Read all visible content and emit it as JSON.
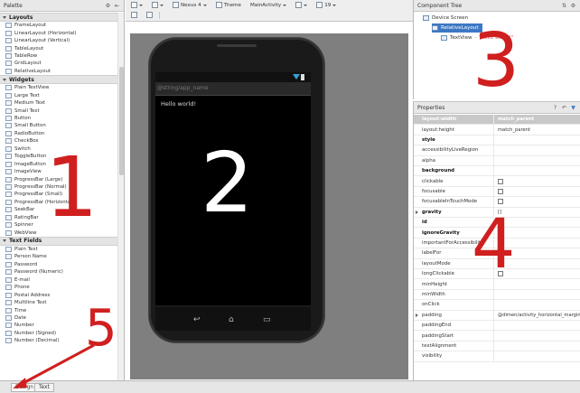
{
  "palette": {
    "title": "Palette",
    "groups": [
      {
        "label": "Layouts",
        "items": [
          "FrameLayout",
          "LinearLayout (Horizontal)",
          "LinearLayout (Vertical)",
          "TableLayout",
          "TableRow",
          "GridLayout",
          "RelativeLayout"
        ]
      },
      {
        "label": "Widgets",
        "items": [
          "Plain TextView",
          "Large Text",
          "Medium Text",
          "Small Text",
          "Button",
          "Small Button",
          "RadioButton",
          "CheckBox",
          "Switch",
          "ToggleButton",
          "ImageButton",
          "ImageView",
          "ProgressBar (Large)",
          "ProgressBar (Normal)",
          "ProgressBar (Small)",
          "ProgressBar (Horizontal)",
          "SeekBar",
          "RatingBar",
          "Spinner",
          "WebView"
        ]
      },
      {
        "label": "Text Fields",
        "items": [
          "Plain Text",
          "Person Name",
          "Password",
          "Password (Numeric)",
          "E-mail",
          "Phone",
          "Postal Address",
          "Multiline Text",
          "Time",
          "Date",
          "Number",
          "Number (Signed)",
          "Number (Decimal)"
        ]
      }
    ]
  },
  "toolbar": {
    "device": "Nexus 4",
    "theme": "Theme",
    "activity": "MainActivity",
    "api": "19"
  },
  "phone": {
    "action_bar_title": "@string/app_name",
    "hello_text": "Hello world!",
    "nav_back": "↩",
    "nav_home": "⌂",
    "nav_recent": "▭"
  },
  "component_tree": {
    "title": "Component Tree",
    "nodes": [
      {
        "label": "Device Screen",
        "depth": 0
      },
      {
        "label": "RelativeLayout",
        "depth": 1,
        "selected": true
      },
      {
        "label": "TextView",
        "depth": 2,
        "suffix": "- \"Hello world!\""
      }
    ]
  },
  "properties": {
    "title": "Properties",
    "rows": [
      {
        "name": "layout:width",
        "value": "match_parent",
        "header": true
      },
      {
        "name": "layout:height",
        "value": "match_parent"
      },
      {
        "name": "style",
        "value": "",
        "bold": true
      },
      {
        "name": "accessibilityLiveRegion",
        "value": ""
      },
      {
        "name": "alpha",
        "value": ""
      },
      {
        "name": "background",
        "value": "",
        "bold": true
      },
      {
        "name": "clickable",
        "value": "",
        "checkbox": true
      },
      {
        "name": "focusable",
        "value": "",
        "checkbox": true
      },
      {
        "name": "focusableInTouchMode",
        "value": "",
        "checkbox": true
      },
      {
        "name": "gravity",
        "value": "[]",
        "bold": true,
        "expand": true
      },
      {
        "name": "id",
        "value": "",
        "bold": true
      },
      {
        "name": "ignoreGravity",
        "value": "",
        "bold": true
      },
      {
        "name": "importantForAccessibility",
        "value": ""
      },
      {
        "name": "labelFor",
        "value": ""
      },
      {
        "name": "layoutMode",
        "value": ""
      },
      {
        "name": "longClickable",
        "value": "",
        "checkbox": true
      },
      {
        "name": "minHeight",
        "value": ""
      },
      {
        "name": "minWidth",
        "value": ""
      },
      {
        "name": "onClick",
        "value": ""
      },
      {
        "name": "padding",
        "value": "@dimen/activity_horizontal_margin",
        "expand": true
      },
      {
        "name": "paddingEnd",
        "value": ""
      },
      {
        "name": "paddingStart",
        "value": ""
      },
      {
        "name": "textAlignment",
        "value": ""
      },
      {
        "name": "visibility",
        "value": ""
      }
    ]
  },
  "bottom_tabs": [
    "Design",
    "Text"
  ],
  "annotations": [
    "1",
    "2",
    "3",
    "4",
    "5"
  ],
  "accent_color": "#d01f1f",
  "selection_color": "#3d78c4"
}
